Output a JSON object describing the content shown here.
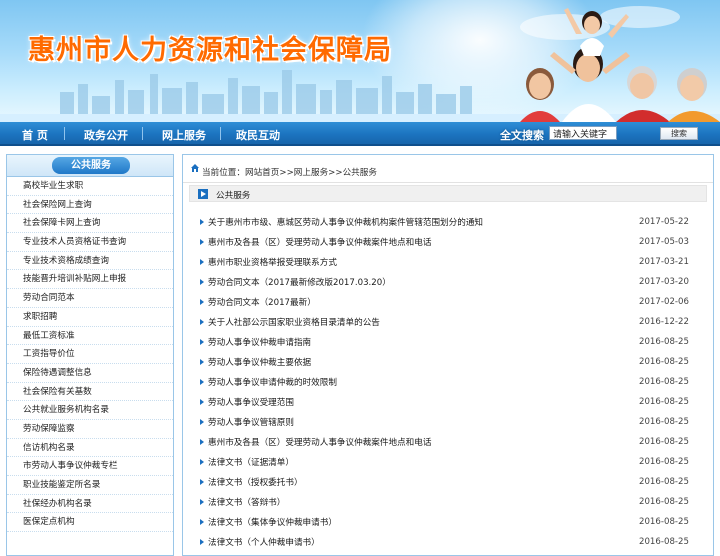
{
  "header": {
    "site_title": "惠州市人力资源和社会保障局"
  },
  "nav": {
    "items": [
      {
        "label": "首 页"
      },
      {
        "label": "政务公开"
      },
      {
        "label": "网上服务"
      },
      {
        "label": "政民互动"
      }
    ],
    "search_label": "全文搜索",
    "search_value": "请输入关键字",
    "search_button": "搜索"
  },
  "sidebar": {
    "title": "公共服务",
    "items": [
      {
        "label": "高校毕业生求职"
      },
      {
        "label": "社会保险网上查询"
      },
      {
        "label": "社会保障卡网上查询"
      },
      {
        "label": "专业技术人员资格证书查询"
      },
      {
        "label": "专业技术资格成绩查询"
      },
      {
        "label": "技能晋升培训补贴网上申报"
      },
      {
        "label": "劳动合同范本"
      },
      {
        "label": "求职招聘"
      },
      {
        "label": "最低工资标准"
      },
      {
        "label": "工资指导价位"
      },
      {
        "label": "保险待遇调整信息"
      },
      {
        "label": "社会保险有关基数"
      },
      {
        "label": "公共就业服务机构名录"
      },
      {
        "label": "劳动保障监察"
      },
      {
        "label": "信访机构名录"
      },
      {
        "label": "市劳动人事争议仲裁专栏"
      },
      {
        "label": "职业技能鉴定所名录"
      },
      {
        "label": "社保经办机构名录"
      },
      {
        "label": "医保定点机构"
      }
    ]
  },
  "main": {
    "breadcrumb": {
      "prefix": "当前位置：",
      "home": "网站首页",
      "sep1": ">>",
      "level1": "网上服务",
      "sep2": ">>",
      "level2": "公共服务"
    },
    "section_title": "公共服务",
    "articles": [
      {
        "title": "关于惠州市市级、惠城区劳动人事争议仲裁机构案件管辖范围划分的通知",
        "date": "2017-05-22"
      },
      {
        "title": "惠州市及各县（区）受理劳动人事争议仲裁案件地点和电话",
        "date": "2017-05-03"
      },
      {
        "title": "惠州市职业资格举报受理联系方式",
        "date": "2017-03-21"
      },
      {
        "title": "劳动合同文本（2017最新修改版2017.03.20）",
        "date": "2017-03-20"
      },
      {
        "title": "劳动合同文本（2017最新）",
        "date": "2017-02-06"
      },
      {
        "title": "关于人社部公示国家职业资格目录清单的公告",
        "date": "2016-12-22"
      },
      {
        "title": "劳动人事争议仲裁申请指南",
        "date": "2016-08-25"
      },
      {
        "title": "劳动人事争议仲裁主要依据",
        "date": "2016-08-25"
      },
      {
        "title": "劳动人事争议申请仲裁的时效限制",
        "date": "2016-08-25"
      },
      {
        "title": "劳动人事争议受理范围",
        "date": "2016-08-25"
      },
      {
        "title": "劳动人事争议管辖原则",
        "date": "2016-08-25"
      },
      {
        "title": "惠州市及各县（区）受理劳动人事争议仲裁案件地点和电话",
        "date": "2016-08-25"
      },
      {
        "title": "法律文书（证据清单）",
        "date": "2016-08-25"
      },
      {
        "title": "法律文书（授权委托书）",
        "date": "2016-08-25"
      },
      {
        "title": "法律文书（答辩书）",
        "date": "2016-08-25"
      },
      {
        "title": "法律文书（集体争议仲裁申请书）",
        "date": "2016-08-25"
      },
      {
        "title": "法律文书（个人仲裁申请书）",
        "date": "2016-08-25"
      }
    ]
  },
  "colors": {
    "title_orange": "#ff6a00",
    "nav_blue": "#1c74c0",
    "bullet_blue": "#1a6fc0"
  }
}
